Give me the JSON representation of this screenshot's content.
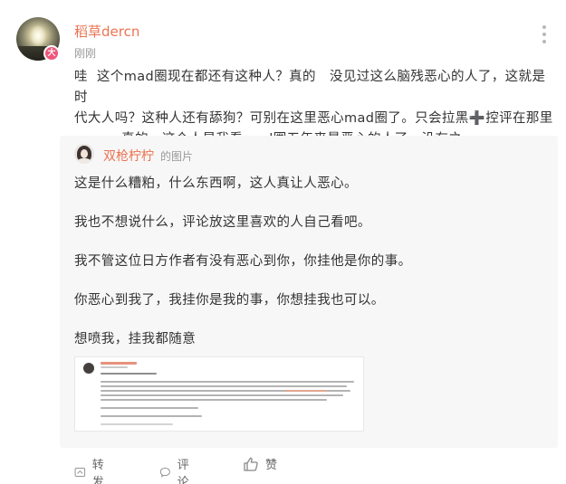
{
  "post": {
    "username": "稻草dercn",
    "timestamp": "刚刚",
    "badge": "大",
    "text_lines": [
      "哇  这个mad圈现在都还有这种人？真的   没见过这么脑残恶心的人了，这就是时",
      "代大人吗？这种人还有舔狗？可别在这里恶心mad圈了。只会拉黑",
      "控评在那里",
      "yygq，真的   这个人是我看mad圈五年来最恶心的人了，没有之一。"
    ],
    "plus_symbol": "➕"
  },
  "repost": {
    "username": "双枪柠柠",
    "suffix": "的图片",
    "lines": [
      "这是什么糟粕，什么东西啊，这人真让人恶心。",
      "我也不想说什么，评论放这里喜欢的人自己看吧。",
      "我不管这位日方作者有没有恶心到你，你挂他是你的事。",
      "你恶心到我了，我挂你是我的事，你想挂我也可以。",
      "想喷我，挂我都随意"
    ]
  },
  "actions": {
    "repost_label": "转发",
    "comment_label": "评论",
    "like_label": "赞"
  },
  "colors": {
    "username": "#eb7350",
    "badge": "#f0567a",
    "meta": "#999999",
    "repost_bg": "#f7f7f7"
  },
  "icons": [
    "more-vertical-icon",
    "repost-icon",
    "comment-icon",
    "like-icon"
  ]
}
